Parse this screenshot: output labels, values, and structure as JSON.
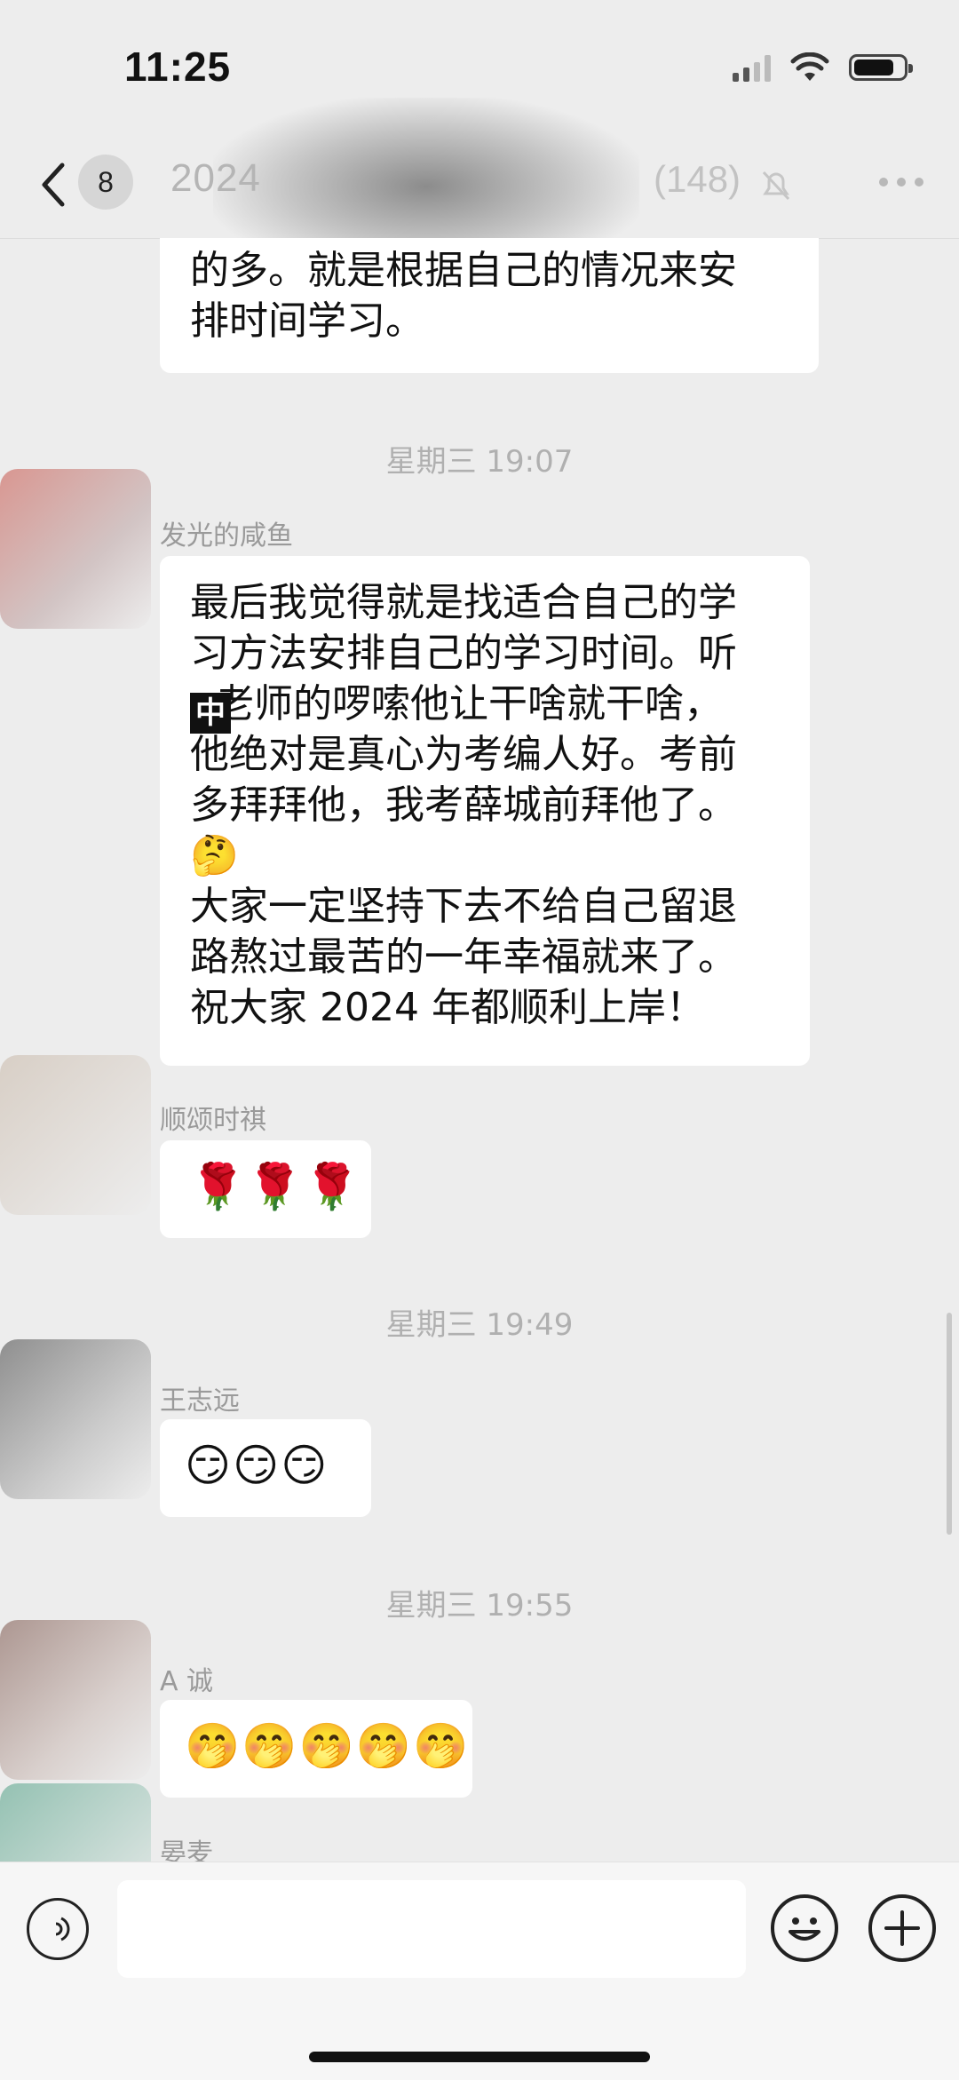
{
  "status": {
    "time": "11:25"
  },
  "nav": {
    "back_label": "<",
    "unread_count": "8",
    "title": "2024",
    "member_count": "(148)"
  },
  "messages": [
    {
      "type": "text_partial",
      "text": "的多。就是根据自己的情况来安\n排时间学习。"
    },
    {
      "type": "time",
      "text": "星期三 19:07"
    },
    {
      "type": "text",
      "sender": "发光的咸鱼",
      "text": "最后我觉得就是找适合自己的学\n习方法安排自己的学习时间。听\n  老师的啰嗦他让干啥就干啥，\n他绝对是真心为考编人好。考前\n多拜拜他，我考薛城前拜他了。\n🤔\n大家一定坚持下去不给自己留退\n路熬过最苦的一年幸福就来了。\n祝大家 2024 年都顺利上岸！",
      "inline_icon": "中"
    },
    {
      "type": "emoji",
      "sender": "顺颂时祺",
      "text": "🌹🌹🌹"
    },
    {
      "type": "time",
      "text": "星期三 19:49"
    },
    {
      "type": "emoji",
      "sender": "王志远",
      "text": "😏😏😏"
    },
    {
      "type": "time",
      "text": "星期三 19:55"
    },
    {
      "type": "emoji",
      "sender": "A 诚",
      "text": "🤭🤭🤭🤭🤭"
    },
    {
      "type": "sender_only",
      "sender": "晏麦"
    }
  ],
  "colors": {
    "background": "#ededed",
    "bubble": "#ffffff",
    "meta_text": "#9a9a9a"
  },
  "icons": {
    "voice": "voice-icon",
    "emoji": "emoji-icon",
    "plus": "plus-icon",
    "bell": "mute-bell-icon",
    "more": "more-icon"
  }
}
